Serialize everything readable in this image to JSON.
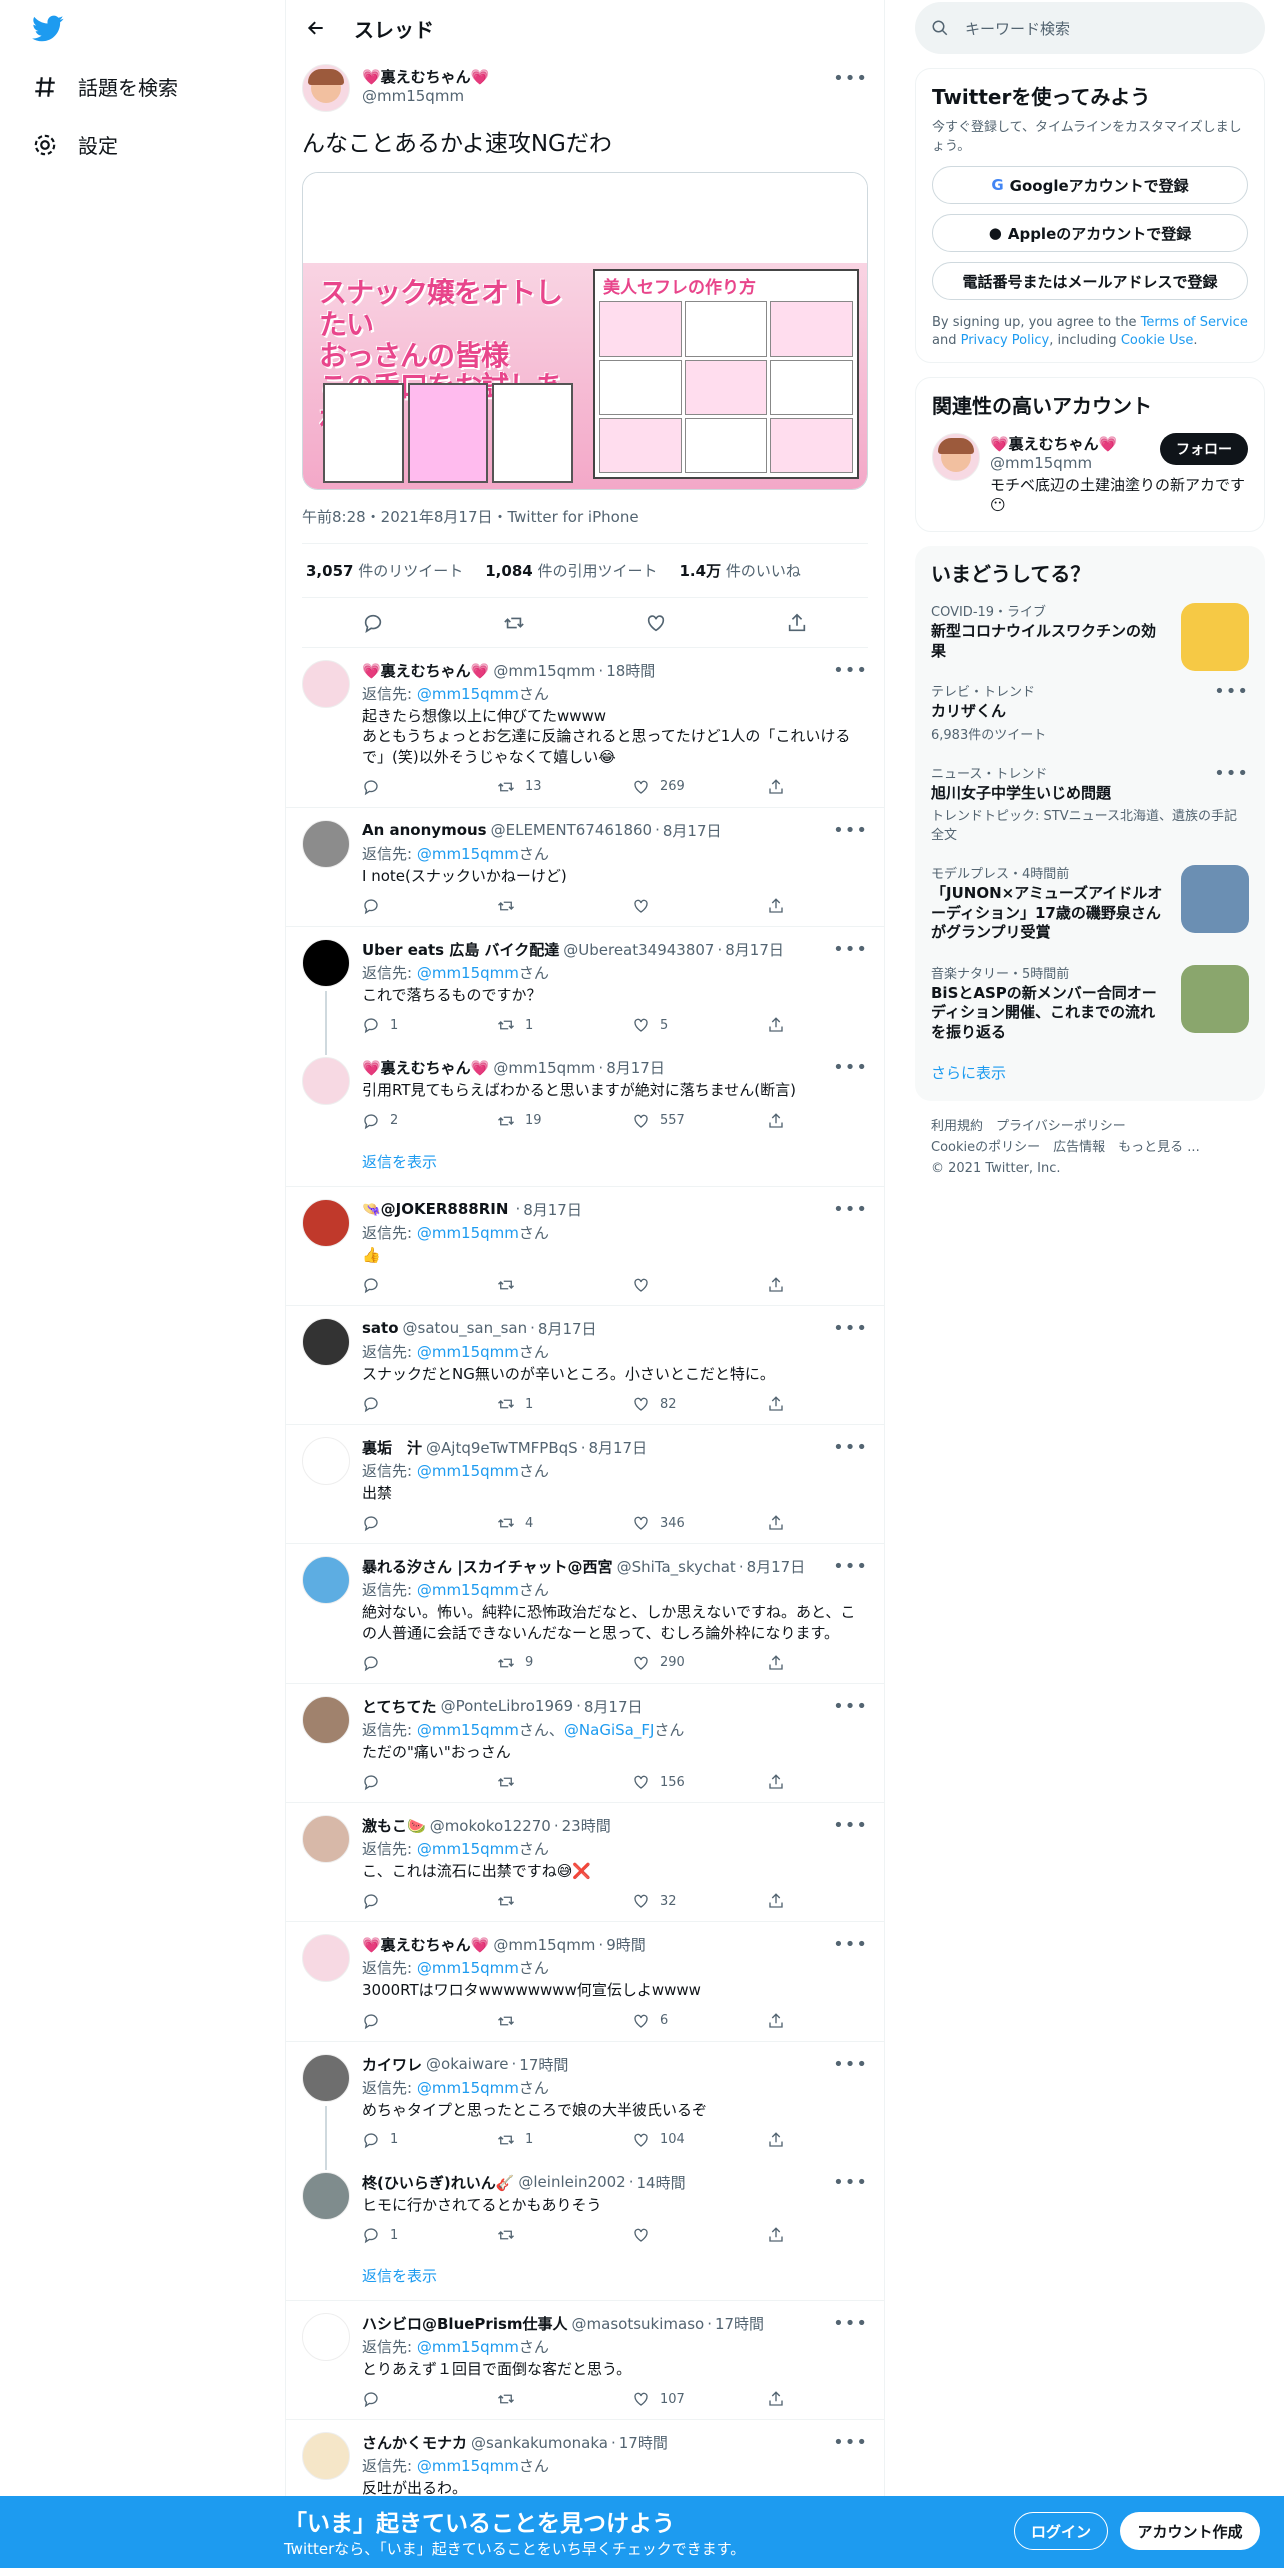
{
  "nav": {
    "explore": "話題を検索",
    "settings": "設定"
  },
  "header": {
    "title": "スレッド"
  },
  "main_tweet": {
    "name": "💗裏えむちゃん💗",
    "handle": "@mm15qmm",
    "text": "んなことあるかよ速攻NGだわ",
    "media_text": {
      "left_headline": [
        "スナック嬢をオトしたい",
        "おっさんの皆様",
        "この手口をお試しあれ"
      ],
      "right_title": "美人セフレの作り方"
    },
    "meta": "午前8:28・2021年8月17日・Twitter for iPhone",
    "retweets": "3,057",
    "retweets_label": "件のリツイート",
    "quotes": "1,084",
    "quotes_label": "件の引用ツイート",
    "likes": "1.4万",
    "likes_label": "件のいいね"
  },
  "replies": [
    {
      "name": "💗裏えむちゃん💗",
      "handle": "@mm15qmm",
      "time": "18時間",
      "reply_to": "@mm15qmm",
      "reply_to_extra": "",
      "text": "起きたら想像以上に伸びてたwwww\nあともうちょっとお乞達に反論されると思ってたけど1人の「これいけるで」(笑)以外そうじゃなくて嬉しい😂",
      "c": "",
      "r": "13",
      "l": "269",
      "avatar": "#f7d9e3"
    },
    {
      "name": "An anonymous",
      "handle": "@ELEMENT67461860",
      "time": "8月17日",
      "reply_to": "@mm15qmm",
      "reply_to_extra": "",
      "text": "I note(スナックいかねーけど)",
      "c": "",
      "r": "",
      "l": "",
      "avatar": "#8c8c8c"
    },
    {
      "name": "Uber eats 広島 バイク配達",
      "handle": "@Ubereat34943807",
      "time": "8月17日",
      "reply_to": "@mm15qmm",
      "reply_to_extra": "",
      "text": "これで落ちるものですか？",
      "c": "1",
      "r": "1",
      "l": "5",
      "avatar": "#000000"
    },
    {
      "name": "💗裏えむちゃん💗",
      "handle": "@mm15qmm",
      "time": "8月17日",
      "reply_to": "",
      "reply_to_extra": "",
      "text": "引用RT見てもらえばわかると思いますが絶対に落ちません(断言)",
      "c": "2",
      "r": "19",
      "l": "557",
      "avatar": "#f7d9e3"
    },
    {
      "name": "👒@JOKER888RIN",
      "handle": "",
      "time": "8月17日",
      "reply_to": "@mm15qmm",
      "reply_to_extra": "",
      "text": "👍",
      "c": "",
      "r": "",
      "l": "",
      "avatar": "#c0392b"
    },
    {
      "name": "sato",
      "handle": "@satou_san_san",
      "time": "8月17日",
      "reply_to": "@mm15qmm",
      "reply_to_extra": "",
      "text": "スナックだとNG無いのが辛いところ。小さいとこだと特に。",
      "c": "",
      "r": "1",
      "l": "82",
      "avatar": "#333333"
    },
    {
      "name": "裏垢　汁",
      "handle": "@Ajtq9eTwTMFPBqS",
      "time": "8月17日",
      "reply_to": "@mm15qmm",
      "reply_to_extra": "",
      "text": "出禁",
      "c": "",
      "r": "4",
      "l": "346",
      "avatar": "#ffffff"
    },
    {
      "name": "暴れる汐さん |スカイチャット@西宮",
      "handle": "@ShiTa_skychat",
      "time": "8月17日",
      "reply_to": "@mm15qmm",
      "reply_to_extra": "",
      "text": "絶対ない。怖い。純粋に恐怖政治だなと、しか思えないですね。あと、この人普通に会話できないんだなーと思って、むしろ論外枠になります。",
      "c": "",
      "r": "9",
      "l": "290",
      "avatar": "#5dade2"
    },
    {
      "name": "とてちてた",
      "handle": "@PonteLibro1969",
      "time": "8月17日",
      "reply_to": "@mm15qmm",
      "reply_to_extra": "@NaGiSa_FJ",
      "text": "ただの\"痛い\"おっさん",
      "c": "",
      "r": "",
      "l": "156",
      "avatar": "#a0826d"
    },
    {
      "name": "激もこ🍉",
      "handle": "@mokoko12270",
      "time": "23時間",
      "reply_to": "@mm15qmm",
      "reply_to_extra": "",
      "text": "こ、これは流石に出禁ですね😅❌",
      "c": "",
      "r": "",
      "l": "32",
      "avatar": "#d7b8a8"
    },
    {
      "name": "💗裏えむちゃん💗",
      "handle": "@mm15qmm",
      "time": "9時間",
      "reply_to": "@mm15qmm",
      "reply_to_extra": "",
      "text": "3000RTはワロタwwwwwwww何宣伝しよwwww",
      "c": "",
      "r": "",
      "l": "6",
      "avatar": "#f7d9e3"
    },
    {
      "name": "カイワレ",
      "handle": "@okaiware",
      "time": "17時間",
      "reply_to": "@mm15qmm",
      "reply_to_extra": "",
      "text": "めちゃタイプと思ったところで娘の大半彼氏いるぞ",
      "c": "1",
      "r": "1",
      "l": "104",
      "avatar": "#6e6e6e"
    },
    {
      "name": "柊(ひいらぎ)れいん🎸",
      "handle": "@leinlein2002",
      "time": "14時間",
      "reply_to": "",
      "reply_to_extra": "",
      "text": "ヒモに行かされてるとかもありそう",
      "c": "1",
      "r": "",
      "l": "",
      "avatar": "#7f8c8d"
    },
    {
      "name": "ハシビロ@BluePrism仕事人",
      "handle": "@masotsukimaso",
      "time": "17時間",
      "reply_to": "@mm15qmm",
      "reply_to_extra": "",
      "text": "とりあえず１回目で面倒な客だと思う。",
      "c": "",
      "r": "",
      "l": "107",
      "avatar": "#ffffff"
    },
    {
      "name": "さんかくモナカ",
      "handle": "@sankakumonaka",
      "time": "17時間",
      "reply_to": "@mm15qmm",
      "reply_to_extra": "",
      "text": "反吐が出るわ。",
      "c": "",
      "r": "",
      "l": "",
      "avatar": "#f5e6c8"
    }
  ],
  "reply_to_prefix": "返信先: ",
  "reply_to_suffix": "さん",
  "reply_to_joiner": "、",
  "show_replies": "返信を表示",
  "right": {
    "search_placeholder": "キーワード検索",
    "signup": {
      "title": "Twitterを使ってみよう",
      "sub": "今すぐ登録して、タイムラインをカスタマイズしましょう。",
      "google": "Googleアカウントで登録",
      "apple": "Appleのアカウントで登録",
      "phone": "電話番号またはメールアドレスで登録",
      "legal_1": "By signing up, you agree to the ",
      "legal_tos": "Terms of Service",
      "legal_2": " and ",
      "legal_pp": "Privacy Policy",
      "legal_3": ", including ",
      "legal_cookie": "Cookie Use",
      "legal_4": "."
    },
    "related": {
      "title": "関連性の高いアカウント",
      "name": "💗裏えむちゃん💗",
      "handle": "@mm15qmm",
      "follow": "フォロー",
      "bio": "モチベ底辺の土建油塗りの新アカです😶"
    },
    "trends": {
      "title": "いまどうしてる？",
      "items": [
        {
          "ctx": "COVID-19・ライブ",
          "title": "新型コロナウイルスワクチンの効果",
          "count": "",
          "topic": ""
        },
        {
          "ctx": "テレビ・トレンド",
          "title": "カリザくん",
          "count": "6,983件のツイート",
          "topic": ""
        },
        {
          "ctx": "ニュース・トレンド",
          "title": "旭川女子中学生いじめ問題",
          "count": "",
          "topic": "トレンドトピック: STVニュース北海道、遺族の手記全文"
        },
        {
          "ctx": "モデルプレス・4時間前",
          "title": "「JUNON×アミューズアイドルオーディション」17歳の磯野泉さんがグランプリ受賞",
          "count": "",
          "topic": ""
        },
        {
          "ctx": "音楽ナタリー・5時間前",
          "title": "BiSとASPの新メンバー合同オーディション開催、これまでの流れを振り返る",
          "count": "",
          "topic": ""
        }
      ],
      "more": "さらに表示"
    },
    "footer": {
      "terms": "利用規約",
      "privacy": "プライバシーポリシー",
      "cookie": "Cookieのポリシー",
      "ads": "広告情報",
      "more": "もっと見る ...",
      "copy": "© 2021 Twitter, Inc."
    }
  },
  "bottom": {
    "big": "「いま」起きていることを見つけよう",
    "small": "Twitterなら、「いま」起きていることをいち早くチェックできます。",
    "login": "ログイン",
    "signup": "アカウント作成"
  },
  "colors": {
    "accent": "#1d9bf0",
    "text": "#0f1419",
    "muted": "#536471",
    "border": "#eff3f4",
    "pink": "#e8458b"
  }
}
